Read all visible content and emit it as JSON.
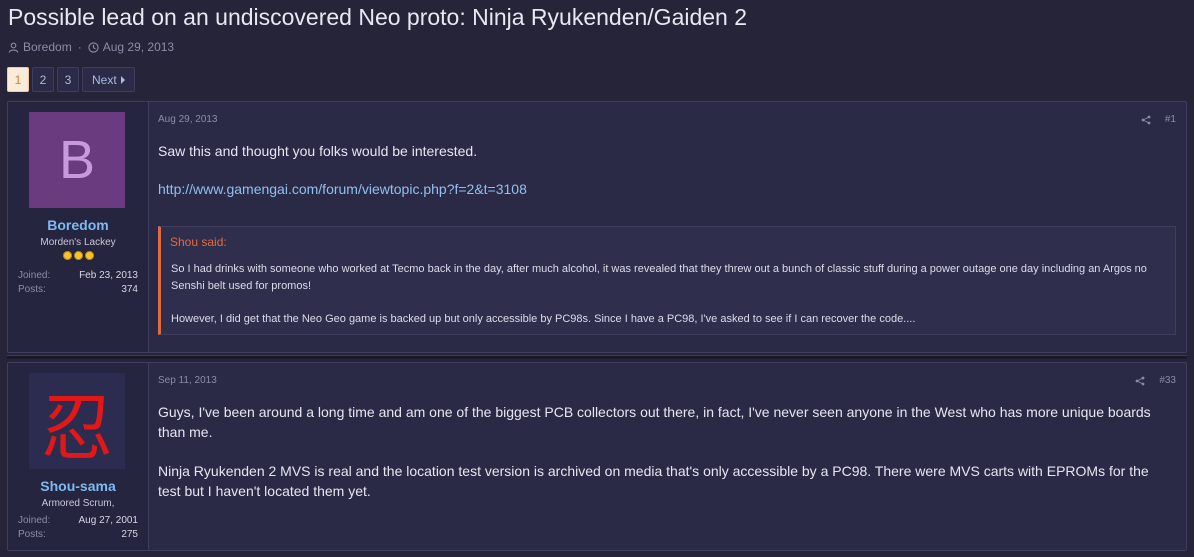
{
  "thread": {
    "title": "Possible lead on an undiscovered Neo proto: Ninja Ryukenden/Gaiden 2",
    "author": "Boredom",
    "date": "Aug 29, 2013"
  },
  "pagination": {
    "pages": [
      "1",
      "2",
      "3"
    ],
    "current": "1",
    "next_label": "Next"
  },
  "posts": [
    {
      "user": {
        "avatar_letter": "B",
        "name": "Boredom",
        "title": "Morden's Lackey",
        "stars": 3,
        "joined_label": "Joined:",
        "joined": "Feb 23, 2013",
        "posts_label": "Posts:",
        "posts": "374"
      },
      "date": "Aug 29, 2013",
      "number": "#1",
      "text1": "Saw this and thought you folks would be interested.",
      "link": "http://www.gamengai.com/forum/viewtopic.php?f=2&t=3108",
      "quote": {
        "header": "Shou said:",
        "para1": "So I had drinks with someone who worked at Tecmo back in the day, after much alcohol, it was revealed that they threw out a bunch of classic stuff during a power outage one day including an Argos no Senshi belt used for promos!",
        "para2": "However, I did get that the Neo Geo game is backed up but only accessible by PC98s. Since I have a PC98, I've asked to see if I can recover the code...."
      }
    },
    {
      "user": {
        "avatar_glyph": "忍",
        "name": "Shou-sama",
        "title": "Armored Scrum,",
        "joined_label": "Joined:",
        "joined": "Aug 27, 2001",
        "posts_label": "Posts:",
        "posts": "275"
      },
      "date": "Sep 11, 2013",
      "number": "#33",
      "para1": "Guys, I've been around a long time and am one of the biggest PCB collectors out there, in fact, I've never seen anyone in the West who has more unique boards than me.",
      "para2": "Ninja Ryukenden 2 MVS is real and the location test version is archived on media that's only accessible by a PC98. There were MVS carts with EPROMs for the test but I haven't located them yet."
    }
  ],
  "colors": {
    "background": "#252438",
    "post_bg": "#2b2a46",
    "username": "#7db9f3",
    "link": "#8fc0ef",
    "quote_accent": "#e36a3e",
    "current_page_bg": "#fbecd9",
    "avatar_b_bg": "#6b3b7f"
  },
  "icons": {
    "author": "user-icon",
    "date": "clock-icon",
    "share": "share-icon",
    "next": "chevron-right-icon",
    "rank": "star-icon"
  }
}
